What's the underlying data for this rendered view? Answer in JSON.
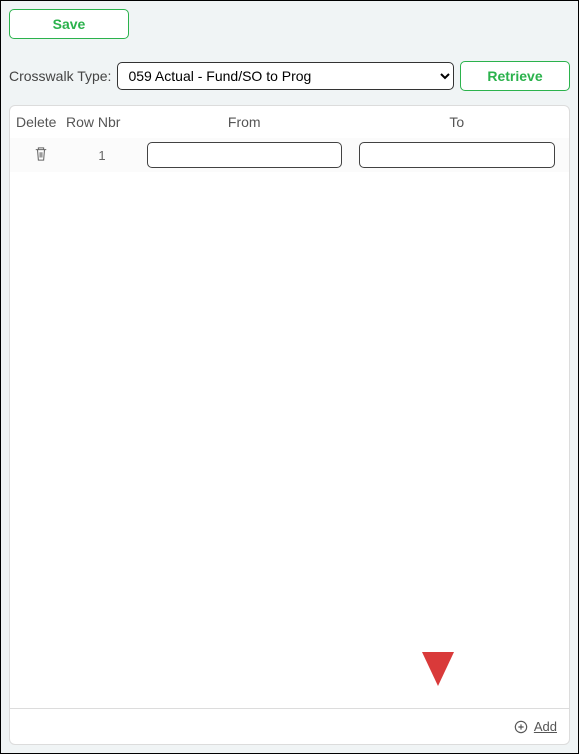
{
  "toolbar": {
    "save_label": "Save"
  },
  "controls": {
    "label": "Crosswalk Type:",
    "selected": "059 Actual - Fund/SO to Prog",
    "retrieve_label": "Retrieve"
  },
  "table": {
    "headers": {
      "delete": "Delete",
      "row_nbr": "Row Nbr",
      "from": "From",
      "to": "To"
    },
    "rows": [
      {
        "nbr": "1",
        "from": "",
        "to": ""
      }
    ],
    "add_label": "Add"
  }
}
